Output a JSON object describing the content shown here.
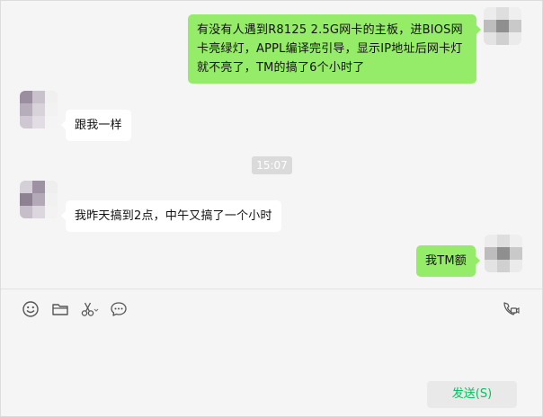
{
  "messages": [
    {
      "side": "right",
      "text": "有没有人遇到R8125 2.5G网卡的主板，进BIOS网卡亮绿灯，APPL编译完引导，显示IP地址后网卡灯就不亮了，TM的搞了6个小时了"
    },
    {
      "side": "left",
      "text": "跟我一样"
    },
    {
      "side": "left",
      "text": "我昨天搞到2点，中午又搞了一个小时"
    },
    {
      "side": "right",
      "text": "我TM额"
    }
  ],
  "timestamp": "15:07",
  "toolbar": {
    "icons": [
      "emoji-icon",
      "folder-icon",
      "scissors-icon",
      "chat-bubble-icon",
      "video-call-icon"
    ]
  },
  "composer": {
    "send_label": "发送(S)"
  },
  "colors": {
    "own_bubble": "#95ec69",
    "other_bubble": "#ffffff",
    "send_text": "#07c160",
    "background": "#f5f5f5"
  }
}
